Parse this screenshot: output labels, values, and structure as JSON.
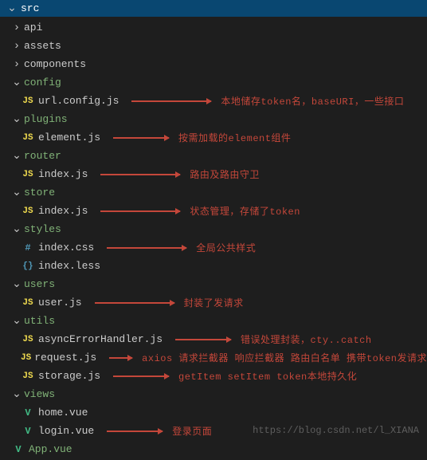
{
  "header": {
    "title": "src"
  },
  "tree": {
    "api": {
      "name": "api"
    },
    "assets": {
      "name": "assets"
    },
    "components": {
      "name": "components"
    },
    "config": {
      "name": "config",
      "files": {
        "urlconfig": {
          "name": "url.config.js",
          "annot": "本地储存token名，baseURI，一些接口"
        }
      }
    },
    "plugins": {
      "name": "plugins",
      "files": {
        "element": {
          "name": "element.js",
          "annot": "按需加载的element组件"
        }
      }
    },
    "router": {
      "name": "router",
      "files": {
        "index": {
          "name": "index.js",
          "annot": "路由及路由守卫"
        }
      }
    },
    "store": {
      "name": "store",
      "files": {
        "index": {
          "name": "index.js",
          "annot": "状态管理，存储了token"
        }
      }
    },
    "styles": {
      "name": "styles",
      "files": {
        "indexcss": {
          "name": "index.css",
          "annot": "全局公共样式"
        },
        "indexless": {
          "name": "index.less"
        }
      }
    },
    "users": {
      "name": "users",
      "files": {
        "user": {
          "name": "user.js",
          "annot": "封装了发请求"
        }
      }
    },
    "utils": {
      "name": "utils",
      "files": {
        "asyncErr": {
          "name": "asyncErrorHandler.js",
          "annot": "错误处理封装，cty..catch"
        },
        "request": {
          "name": "request.js",
          "annot": "axios 请求拦截器 响应拦截器 路由白名单 携带token发请求"
        },
        "storage": {
          "name": "storage.js",
          "annot": "getItem setItem token本地持久化"
        }
      }
    },
    "views": {
      "name": "views",
      "files": {
        "home": {
          "name": "home.vue"
        },
        "login": {
          "name": "login.vue",
          "annot": "登录页面"
        }
      }
    },
    "appvue": {
      "name": "App.vue"
    }
  },
  "watermark": "https://blog.csdn.net/l_XIANA"
}
